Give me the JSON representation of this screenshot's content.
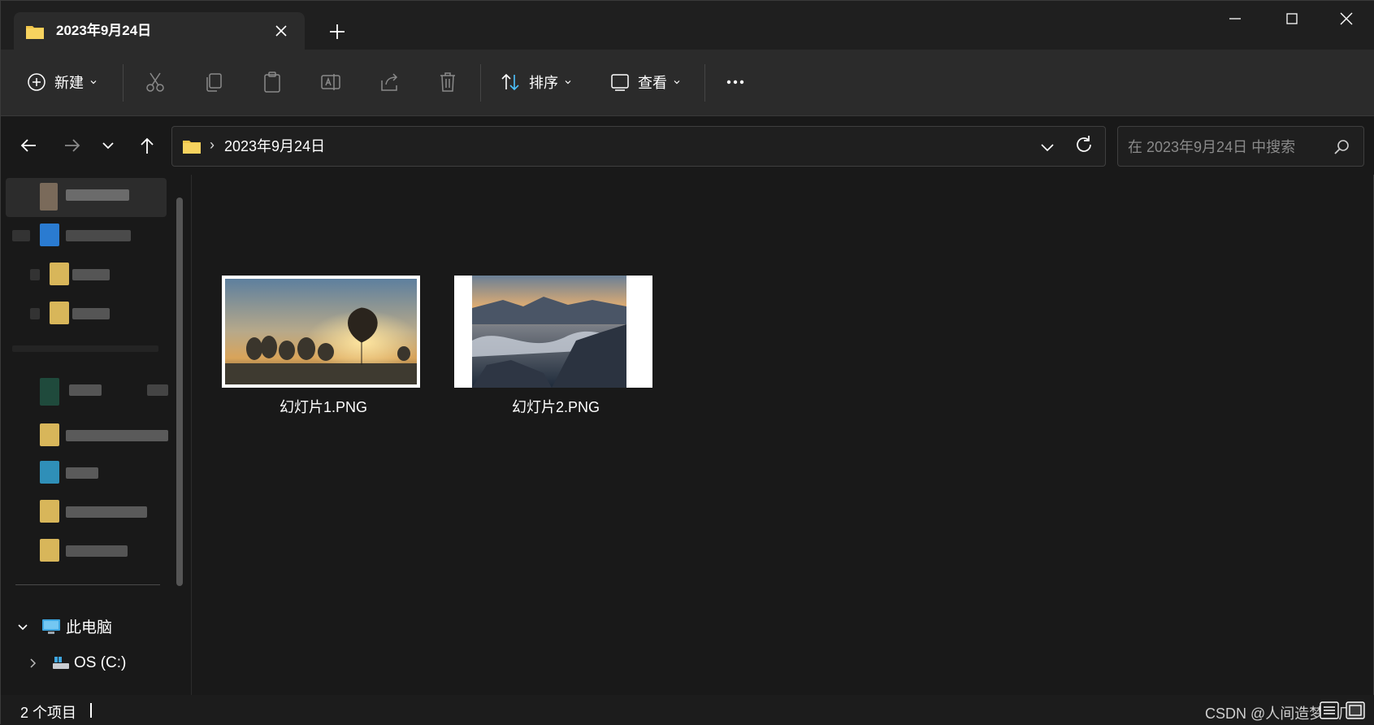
{
  "tab": {
    "title": "2023年9月24日"
  },
  "toolbar": {
    "new_label": "新建",
    "sort_label": "排序",
    "view_label": "查看"
  },
  "address": {
    "path_segment": "2023年9月24日",
    "separator": "›"
  },
  "search": {
    "placeholder": "在 2023年9月24日 中搜索"
  },
  "sidebar": {
    "this_pc": "此电脑",
    "drive_c": "OS (C:)"
  },
  "files": [
    {
      "name": "幻灯片1.PNG"
    },
    {
      "name": "幻灯片2.PNG"
    }
  ],
  "status": {
    "item_count": "2 个项目"
  },
  "watermark": "CSDN @人间造梦工厂",
  "colors": {
    "folder": "#f0c54a",
    "accent": "#4cc2ff",
    "background": "#191919",
    "toolbar": "#2b2b2b"
  }
}
